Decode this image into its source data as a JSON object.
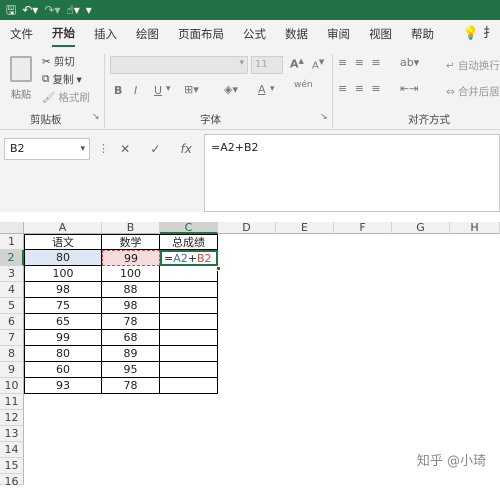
{
  "quick_access": {
    "save_icon": "save-icon",
    "undo_icon": "undo-icon",
    "redo_icon": "redo-icon",
    "touch_icon": "touch-mode-icon",
    "customize_icon": "customize-icon"
  },
  "menu_tabs": [
    "文件",
    "开始",
    "插入",
    "绘图",
    "页面布局",
    "公式",
    "数据",
    "审阅",
    "视图",
    "帮助"
  ],
  "ribbon": {
    "clipboard": {
      "paste": "粘贴",
      "cut": "剪切",
      "copy": "复制",
      "format_painter": "格式刷",
      "label": "剪贴板"
    },
    "font": {
      "label": "字体",
      "size": "11",
      "grow": "A",
      "shrink": "A",
      "bold": "B",
      "italic": "I",
      "underline": "U",
      "font_color": "A",
      "phonetic": "wén"
    },
    "alignment": {
      "label": "对齐方式",
      "wrap_text": "自动换行",
      "merge": "合并后居"
    }
  },
  "formula_bar": {
    "name_box": "B2",
    "formula": "=A2+B2",
    "cancel": "✕",
    "enter": "✓",
    "fx": "fx"
  },
  "sheet": {
    "columns": [
      "A",
      "B",
      "C",
      "D",
      "E",
      "F",
      "G",
      "H"
    ],
    "rows": [
      "1",
      "2",
      "3",
      "4",
      "5",
      "6",
      "7",
      "8",
      "9",
      "10",
      "11",
      "12",
      "13",
      "14",
      "15",
      "16",
      "17"
    ],
    "headers": [
      "语文",
      "数学",
      "总成绩"
    ],
    "data": [
      [
        "80",
        "99"
      ],
      [
        "100",
        "100"
      ],
      [
        "98",
        "88"
      ],
      [
        "75",
        "98"
      ],
      [
        "65",
        "78"
      ],
      [
        "99",
        "68"
      ],
      [
        "80",
        "89"
      ],
      [
        "60",
        "95"
      ],
      [
        "93",
        "78"
      ]
    ],
    "c2_formula_parts": {
      "eq": "=",
      "a": "A2",
      "plus": "+",
      "b": "B2"
    }
  },
  "watermark": "知乎 @小琦",
  "colors": {
    "accent": "#217346",
    "ref_a": "#3e6fb4",
    "ref_b": "#c0504d"
  }
}
